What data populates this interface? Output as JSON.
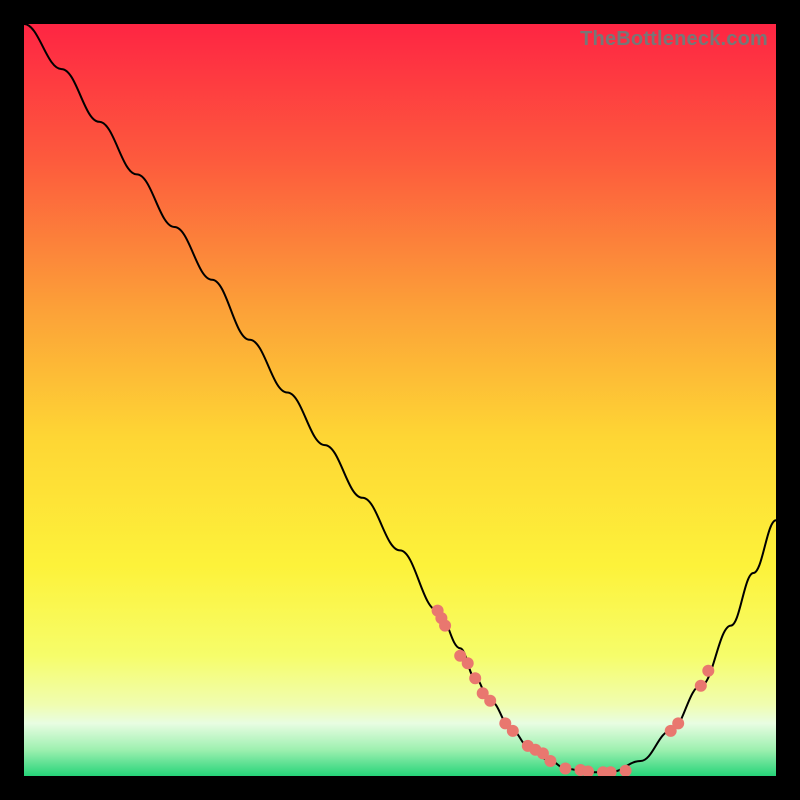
{
  "watermark": "TheBottleneck.com",
  "chart_data": {
    "type": "line",
    "title": "",
    "xlabel": "",
    "ylabel": "",
    "xlim": [
      0,
      100
    ],
    "ylim": [
      0,
      100
    ],
    "grid": false,
    "legend": false,
    "background_gradient": {
      "top": "#fe2543",
      "mid_upper": "#fc8e3a",
      "mid": "#fee734",
      "mid_lower": "#f5fc64",
      "bottom_band": "#e8fde2",
      "bottom": "#26d479"
    },
    "series": [
      {
        "name": "bottleneck-curve",
        "x": [
          0,
          5,
          10,
          15,
          20,
          25,
          30,
          35,
          40,
          45,
          50,
          55,
          58,
          60,
          62,
          65,
          67,
          70,
          72,
          75,
          78,
          82,
          86,
          90,
          94,
          97,
          100
        ],
        "y": [
          100,
          94,
          87,
          80,
          73,
          66,
          58,
          51,
          44,
          37,
          30,
          22,
          17,
          13,
          10,
          6,
          4,
          2,
          1,
          0.5,
          0.5,
          2,
          6,
          12,
          20,
          27,
          34
        ]
      }
    ],
    "markers": {
      "name": "highlight-points",
      "x": [
        55,
        55.5,
        56,
        58,
        59,
        60,
        61,
        62,
        64,
        65,
        67,
        68,
        69,
        70,
        72,
        74,
        75,
        77,
        78,
        80,
        86,
        87,
        90,
        91
      ],
      "y": [
        22,
        21,
        20,
        16,
        15,
        13,
        11,
        10,
        7,
        6,
        4,
        3.5,
        3,
        2,
        1,
        0.8,
        0.6,
        0.5,
        0.5,
        0.7,
        6,
        7,
        12,
        14
      ]
    }
  }
}
